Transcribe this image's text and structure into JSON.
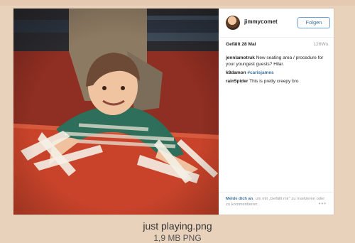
{
  "post": {
    "username": "jimmycomet",
    "follow_label": "Folgen",
    "likes_label": "Gefällt 28 Mal",
    "age_label": "126Wo.",
    "comments": [
      {
        "user": "jennlamotruk",
        "text": "New seating area / procedure for your youngest guests? Hilar."
      },
      {
        "user": "k8damon",
        "tag": "#carisjames"
      },
      {
        "user": "rain5pider",
        "text": "This is pretty creepy bro"
      }
    ],
    "footer_link": "Melde dich an",
    "footer_text": ", um mit „Gefällt mir“ zu markieren oder zu kommentieren.",
    "more_icon": "•••"
  },
  "file": {
    "name": "just playing.png",
    "info": "1,9 MB PNG"
  },
  "colors": {
    "background": "#e9d2bc",
    "table_red": "#c9432a",
    "link_blue": "#3f729b",
    "follow_border": "#6fa1d6"
  },
  "icons": {
    "avatar": "profile-avatar",
    "more": "ellipsis-icon"
  }
}
